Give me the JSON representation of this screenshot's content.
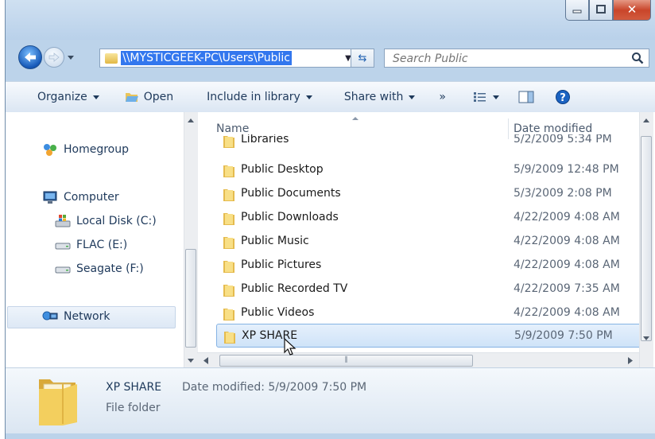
{
  "address": {
    "path": "\\\\MYSTICGEEK-PC\\Users\\Public"
  },
  "search": {
    "placeholder": "Search Public"
  },
  "toolbar": {
    "organize": "Organize",
    "open": "Open",
    "include_in_library": "Include in library",
    "share_with": "Share with",
    "overflow": "»"
  },
  "nav": {
    "homegroup": "Homegroup",
    "computer": "Computer",
    "drives": [
      {
        "label": "Local Disk (C:)"
      },
      {
        "label": "FLAC (E:)"
      },
      {
        "label": "Seagate (F:)"
      }
    ],
    "network": "Network"
  },
  "columns": {
    "name": "Name",
    "date": "Date modified"
  },
  "files": [
    {
      "name": "Libraries",
      "date": "5/2/2009 5:34 PM"
    },
    {
      "name": "Public Desktop",
      "date": "5/9/2009 12:48 PM"
    },
    {
      "name": "Public Documents",
      "date": "5/3/2009 2:08 PM"
    },
    {
      "name": "Public Downloads",
      "date": "4/22/2009 4:08 AM"
    },
    {
      "name": "Public Music",
      "date": "4/22/2009 4:08 AM"
    },
    {
      "name": "Public Pictures",
      "date": "4/22/2009 4:08 AM"
    },
    {
      "name": "Public Recorded TV",
      "date": "4/22/2009 7:35 AM"
    },
    {
      "name": "Public Videos",
      "date": "4/22/2009 4:08 AM"
    },
    {
      "name": "XP SHARE",
      "date": "5/9/2009 7:50 PM"
    }
  ],
  "details": {
    "name": "XP SHARE",
    "date_text": "Date modified: 5/9/2009 7:50 PM",
    "type": "File folder"
  },
  "colors": {
    "accent": "#3377ee",
    "selection_bg": "#cfe3f8",
    "link_text": "#1e395b"
  }
}
